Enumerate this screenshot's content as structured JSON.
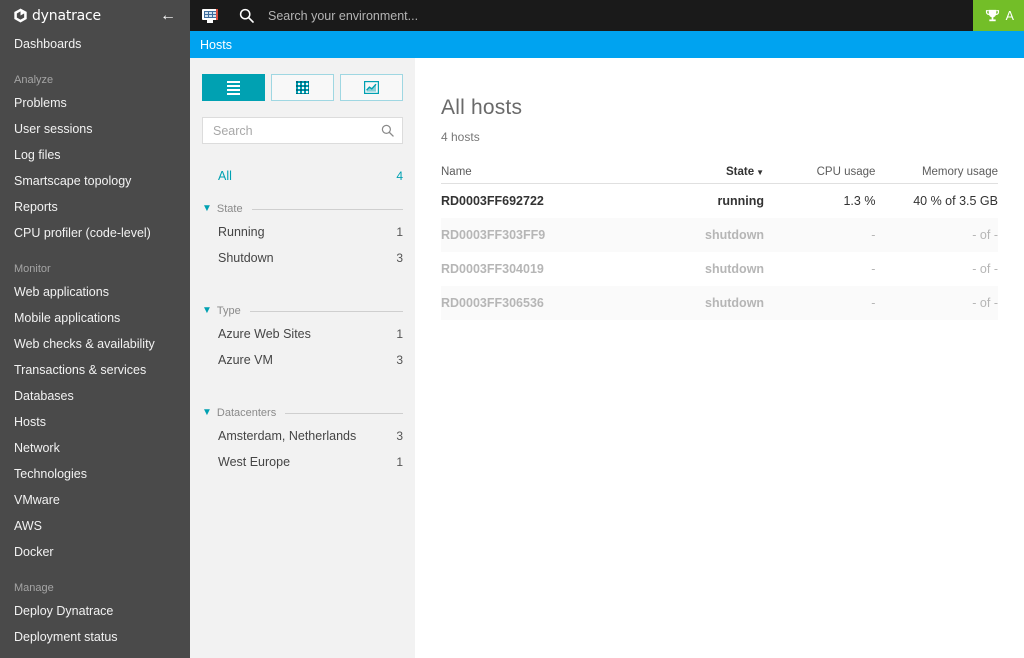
{
  "sidebar": {
    "brand": "dynatrace",
    "collapse_icon": "left-arrow-icon",
    "items": [
      {
        "type": "item",
        "label": "Dashboards"
      },
      {
        "type": "gap"
      },
      {
        "type": "group",
        "label": "Analyze"
      },
      {
        "type": "item",
        "label": "Problems"
      },
      {
        "type": "item",
        "label": "User sessions"
      },
      {
        "type": "item",
        "label": "Log files"
      },
      {
        "type": "item",
        "label": "Smartscape topology"
      },
      {
        "type": "item",
        "label": "Reports"
      },
      {
        "type": "item",
        "label": "CPU profiler (code-level)"
      },
      {
        "type": "gap"
      },
      {
        "type": "group",
        "label": "Monitor"
      },
      {
        "type": "item",
        "label": "Web applications"
      },
      {
        "type": "item",
        "label": "Mobile applications"
      },
      {
        "type": "item",
        "label": "Web checks & availability"
      },
      {
        "type": "item",
        "label": "Transactions & services"
      },
      {
        "type": "item",
        "label": "Databases"
      },
      {
        "type": "item",
        "label": "Hosts"
      },
      {
        "type": "item",
        "label": "Network"
      },
      {
        "type": "item",
        "label": "Technologies"
      },
      {
        "type": "item",
        "label": "VMware"
      },
      {
        "type": "item",
        "label": "AWS"
      },
      {
        "type": "item",
        "label": "Docker"
      },
      {
        "type": "gap"
      },
      {
        "type": "group",
        "label": "Manage"
      },
      {
        "type": "item",
        "label": "Deploy Dynatrace"
      },
      {
        "type": "item",
        "label": "Deployment status"
      }
    ]
  },
  "topbar": {
    "screen_icon": "monitor-icon",
    "search_icon": "search-icon",
    "search_placeholder": "Search your environment...",
    "right_badge": {
      "icon": "trophy-icon",
      "label": "A"
    }
  },
  "pagebar": {
    "title": "Hosts"
  },
  "filter_panel": {
    "view_toggles": [
      {
        "name": "list-view",
        "icon": "list-view-icon",
        "active": true
      },
      {
        "name": "grid-view",
        "icon": "grid-view-icon",
        "active": false
      },
      {
        "name": "chart-view",
        "icon": "chart-view-icon",
        "active": false
      }
    ],
    "search": {
      "value": "",
      "placeholder": "Search",
      "icon": "search-icon"
    },
    "all": {
      "label": "All",
      "count": "4"
    },
    "groups": [
      {
        "name": "State",
        "rows": [
          {
            "label": "Running",
            "count": "1"
          },
          {
            "label": "Shutdown",
            "count": "3"
          }
        ]
      },
      {
        "name": "Type",
        "rows": [
          {
            "label": "Azure Web Sites",
            "count": "1"
          },
          {
            "label": "Azure VM",
            "count": "3"
          }
        ]
      },
      {
        "name": "Datacenters",
        "rows": [
          {
            "label": "Amsterdam, Netherlands",
            "count": "3"
          },
          {
            "label": "West Europe",
            "count": "1"
          }
        ]
      }
    ]
  },
  "main": {
    "title": "All hosts",
    "subtitle": "4 hosts",
    "columns": [
      {
        "label": "Name",
        "sorted": false
      },
      {
        "label": "State",
        "sorted": true,
        "caret": "▼"
      },
      {
        "label": "CPU usage",
        "sorted": false
      },
      {
        "label": "Memory usage",
        "sorted": false
      }
    ],
    "rows": [
      {
        "name": "RD0003FF692722",
        "state": "running",
        "cpu": "1.3 %",
        "memory": "40 % of 3.5 GB",
        "dim": false
      },
      {
        "name": "RD0003FF303FF9",
        "state": "shutdown",
        "cpu": "-",
        "memory": "- of -",
        "dim": true
      },
      {
        "name": "RD0003FF304019",
        "state": "shutdown",
        "cpu": "-",
        "memory": "- of -",
        "dim": true
      },
      {
        "name": "RD0003FF306536",
        "state": "shutdown",
        "cpu": "-",
        "memory": "- of -",
        "dim": true
      }
    ]
  },
  "colors": {
    "sidebar_bg": "#4a4a4a",
    "topbar_bg": "#1a1a1a",
    "page_bar_blue": "#00a3f0",
    "accent_teal": "#00a1b2",
    "badge_green": "#73be28",
    "panel_bg": "#f2f2f2"
  }
}
